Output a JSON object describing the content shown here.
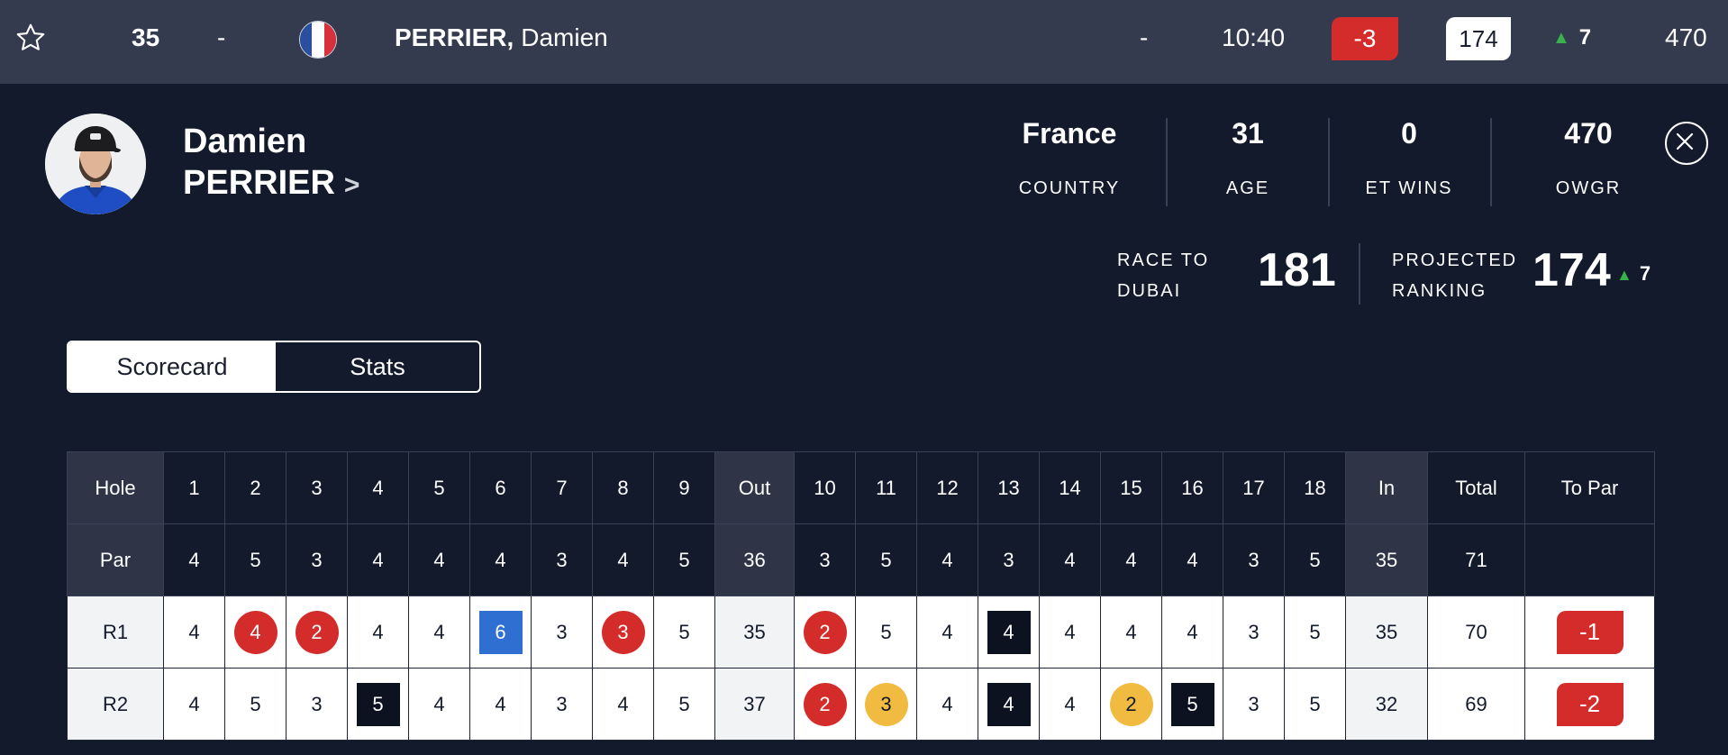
{
  "topbar": {
    "position": "35",
    "dash1": "-",
    "player_last": "PERRIER,",
    "player_first": "Damien",
    "dash2": "-",
    "tee_time": "10:40",
    "score": "-3",
    "rank": "174",
    "movement": "7",
    "points": "470",
    "score_color": "#d42b2b",
    "movement_color": "#38b24a"
  },
  "profile": {
    "first_name": "Damien",
    "last_name": "PERRIER",
    "stats": [
      {
        "value": "France",
        "label": "COUNTRY"
      },
      {
        "value": "31",
        "label": "AGE"
      },
      {
        "value": "0",
        "label": "ET WINS"
      },
      {
        "value": "470",
        "label": "OWGR"
      }
    ],
    "race_label_1": "RACE TO",
    "race_label_2": "DUBAI",
    "race_value": "181",
    "proj_label_1": "PROJECTED",
    "proj_label_2": "RANKING",
    "proj_value": "174",
    "proj_movement": "7"
  },
  "tabs": [
    {
      "label": "Scorecard",
      "active": true
    },
    {
      "label": "Stats",
      "active": false
    }
  ],
  "scorecard": {
    "header": [
      "Hole",
      "1",
      "2",
      "3",
      "4",
      "5",
      "6",
      "7",
      "8",
      "9",
      "Out",
      "10",
      "11",
      "12",
      "13",
      "14",
      "15",
      "16",
      "17",
      "18",
      "In",
      "Total",
      "To Par"
    ],
    "par": [
      "Par",
      "4",
      "5",
      "3",
      "4",
      "4",
      "4",
      "3",
      "4",
      "5",
      "36",
      "3",
      "5",
      "4",
      "3",
      "4",
      "4",
      "4",
      "3",
      "5",
      "35",
      "71",
      ""
    ],
    "rounds": [
      {
        "label": "R1",
        "scores": [
          "4",
          "4",
          "2",
          "4",
          "4",
          "6",
          "3",
          "3",
          "5",
          "35",
          "2",
          "5",
          "4",
          "4",
          "4",
          "4",
          "4",
          "3",
          "5",
          "35",
          "70",
          "-1"
        ],
        "marks": [
          "",
          "birdie",
          "birdie",
          "",
          "",
          "dbl",
          "",
          "birdie",
          "",
          "",
          "birdie",
          "",
          "",
          "bogey",
          "",
          "",
          "",
          "",
          "",
          "",
          "",
          "topar"
        ]
      },
      {
        "label": "R2",
        "scores": [
          "4",
          "5",
          "3",
          "5",
          "4",
          "4",
          "3",
          "4",
          "5",
          "37",
          "2",
          "3",
          "4",
          "4",
          "4",
          "2",
          "5",
          "3",
          "5",
          "32",
          "69",
          "-2"
        ],
        "marks": [
          "",
          "",
          "",
          "bogey",
          "",
          "",
          "",
          "",
          "",
          "",
          "birdie",
          "eagle",
          "",
          "bogey",
          "",
          "eagle",
          "bogey",
          "",
          "",
          "",
          "",
          "topar"
        ]
      }
    ]
  },
  "colors": {
    "background": "#121a2b",
    "topbar": "#353b4f",
    "birdie": "#d42b2b",
    "eagle": "#f1bb42",
    "bogey": "#0d1220",
    "double_bogey": "#2e6fd1"
  }
}
